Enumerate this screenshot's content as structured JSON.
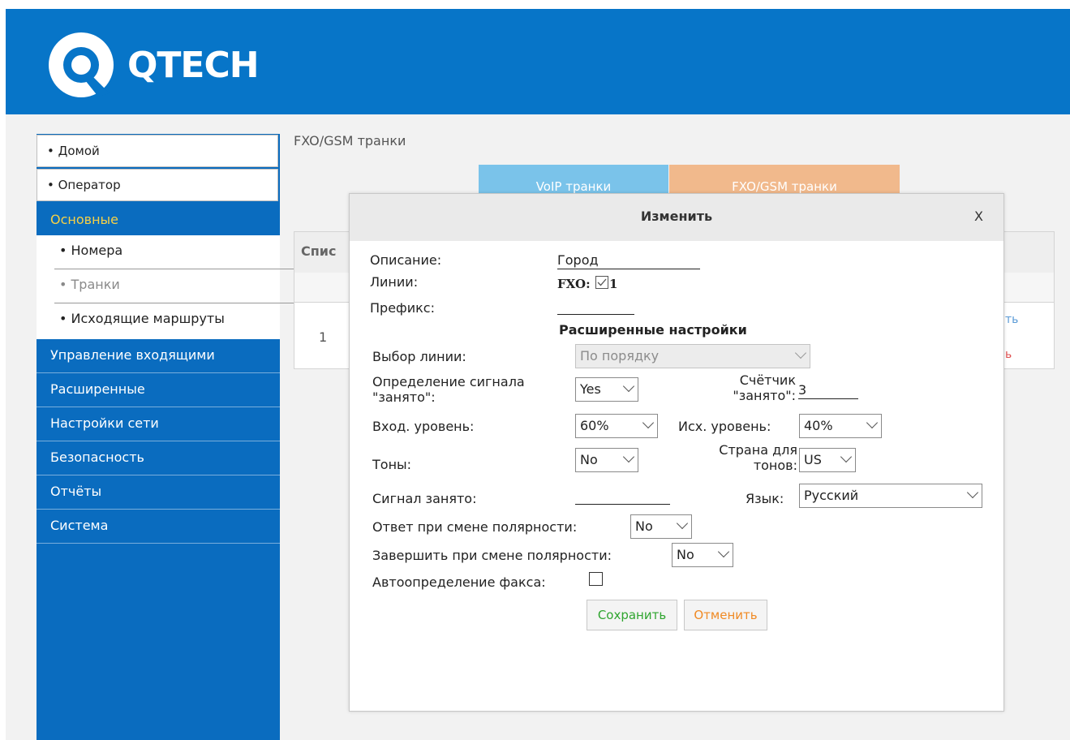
{
  "brand": {
    "name": "QTECH",
    "color": "#0775c8"
  },
  "sidebar": {
    "top_items": [
      {
        "label": "• Домой"
      },
      {
        "label": "• Оператор"
      }
    ],
    "section_active": "Основные",
    "sub_items": [
      {
        "label": "• Номера"
      },
      {
        "label": "• Транки"
      },
      {
        "label": "• Исходящие маршруты"
      }
    ],
    "sections": [
      {
        "label": "Управление входящими"
      },
      {
        "label": "Расширенные"
      },
      {
        "label": "Настройки сети"
      },
      {
        "label": "Безопасность"
      },
      {
        "label": "Отчёты"
      },
      {
        "label": "Система"
      }
    ]
  },
  "breadcrumb": "FXO/GSM транки",
  "tabs": [
    {
      "label": "VoIP транки"
    },
    {
      "label": "FXO/GSM транки"
    }
  ],
  "bg_table": {
    "header": "Спис",
    "row_index": "1",
    "link1": "ть",
    "link2": "ь"
  },
  "modal": {
    "title": "Изменить",
    "close": "X",
    "description_label": "Описание:",
    "description_value": "Город",
    "lines_label": "Линии:",
    "fxo_label": "FXO:",
    "fxo_line_number": "1",
    "prefix_label": "Префикс:",
    "prefix_value": "",
    "advanced_title": "Расширенные настройки",
    "line_select_label": "Выбор линии:",
    "line_select_value": "По порядку",
    "busy_detect_label_1": "Определение сигнала",
    "busy_detect_label_2": "\"занято\":",
    "busy_detect_value": "Yes",
    "busy_count_label_1": "Счётчик",
    "busy_count_label_2": "\"занято\":",
    "busy_count_value": "3",
    "rx_level_label": "Вход. уровень:",
    "rx_level_value": "60%",
    "tx_level_label": "Исх. уровень:",
    "tx_level_value": "40%",
    "tones_label": "Тоны:",
    "tones_value": "No",
    "tone_country_label_1": "Страна для",
    "tone_country_label_2": "тонов:",
    "tone_country_value": "US",
    "busy_signal_label": "Сигнал занято:",
    "busy_signal_value": "",
    "language_label": "Язык:",
    "language_value": "Русский",
    "polarity_answer_label": "Ответ при смене полярности:",
    "polarity_answer_value": "No",
    "polarity_hangup_label": "Завершить при смене полярности:",
    "polarity_hangup_value": "No",
    "fax_detect_label": "Автоопределение факса:",
    "save_label": "Сохранить",
    "cancel_label": "Отменить",
    "save_color": "#2fa52f",
    "cancel_color": "#f08a24"
  }
}
